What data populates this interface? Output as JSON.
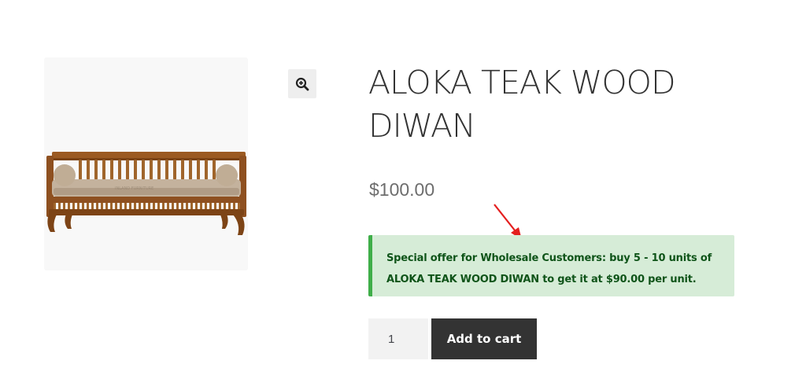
{
  "product": {
    "title": "ALOKA TEAK WOOD DIWAN",
    "price": "$100.00",
    "image_alt": "Aloka teak wood diwan",
    "image_watermark": "INLAND FURNITURE"
  },
  "notice": {
    "line1": "Special offer for Wholesale Customers: buy 5 - 10 units of",
    "line2": "ALOKA TEAK WOOD DIWAN to get it at $90.00 per unit."
  },
  "cart": {
    "quantity": "1",
    "button_label": "Add to cart"
  },
  "icons": {
    "zoom": "zoom-in-icon",
    "annotation": "red-arrow"
  },
  "colors": {
    "notice_background": "#d6ecd7",
    "notice_border": "#3fae49",
    "notice_text": "#0f5419",
    "button_background": "#333333",
    "arrow": "#e41e1e"
  }
}
